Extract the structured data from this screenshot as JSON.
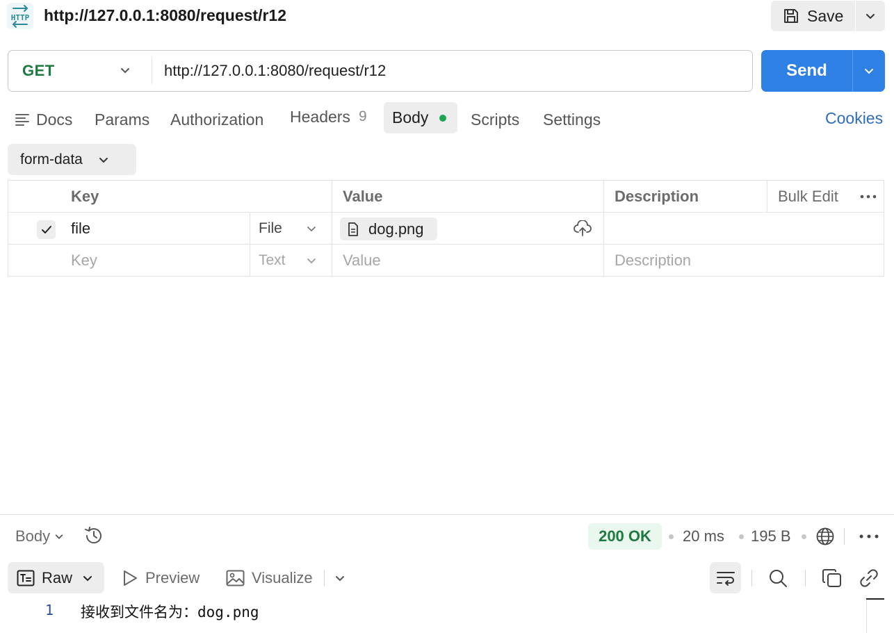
{
  "header": {
    "logo_text": "HTTP",
    "title": "http://127.0.0.1:8080/request/r12",
    "save_label": "Save"
  },
  "request": {
    "method": "GET",
    "url": "http://127.0.0.1:8080/request/r12",
    "send_label": "Send"
  },
  "tabs": {
    "docs": "Docs",
    "params": "Params",
    "authorization": "Authorization",
    "headers": "Headers",
    "headers_count": "9",
    "body": "Body",
    "scripts": "Scripts",
    "settings": "Settings",
    "cookies": "Cookies"
  },
  "body_mode": "form-data",
  "table": {
    "headers": {
      "key": "Key",
      "value": "Value",
      "description": "Description",
      "bulk_edit": "Bulk Edit"
    },
    "rows": [
      {
        "key": "file",
        "type": "File",
        "value": "dog.png",
        "description": ""
      }
    ],
    "new_row": {
      "key": "Key",
      "type": "Text",
      "value": "Value",
      "description": "Description"
    }
  },
  "response": {
    "view_label": "Body",
    "status": "200 OK",
    "time": "20 ms",
    "size": "195 B",
    "format_raw": "Raw",
    "format_preview": "Preview",
    "format_visualize": "Visualize",
    "lines": [
      {
        "number": "1",
        "text": "接收到文件名为：dog.png"
      }
    ]
  },
  "colors": {
    "send_button": "#2f80e4",
    "method_get": "#1f7a3f",
    "status_ok": "#1f7a3f",
    "link": "#2f6bc1",
    "body_dot": "#1ea453"
  }
}
